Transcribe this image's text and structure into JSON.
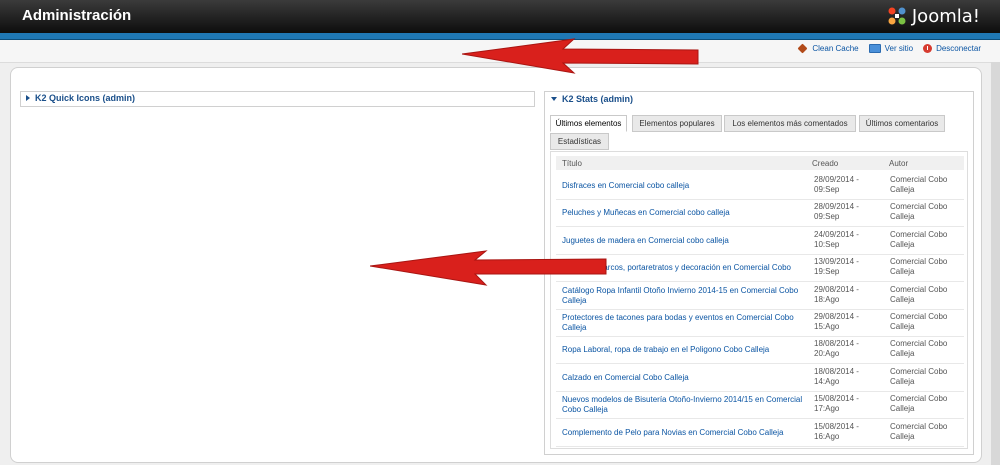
{
  "header": {
    "title": "Administración",
    "logo_text": "Joomla!"
  },
  "toolbar": {
    "clean_cache": "Clean Cache",
    "view_site": "Ver sitio",
    "logout": "Desconectar"
  },
  "left_panel": {
    "title": "K2 Quick Icons (admin)"
  },
  "right_panel": {
    "title": "K2 Stats (admin)",
    "tabs": [
      {
        "label": "Últimos elementos",
        "active": true
      },
      {
        "label": "Elementos populares",
        "active": false
      },
      {
        "label": "Los elementos más comentados",
        "active": false
      },
      {
        "label": "Últimos comentarios",
        "active": false
      },
      {
        "label": "Estadísticas",
        "active": false
      }
    ],
    "columns": {
      "title": "Título",
      "created": "Creado",
      "author": "Autor"
    },
    "rows": [
      {
        "title": "Disfraces en Comercial cobo calleja",
        "created": "28/09/2014 - 09:Sep",
        "author": "Comercial Cobo Calleja"
      },
      {
        "title": "Peluches y Muñecas en Comercial cobo calleja",
        "created": "28/09/2014 - 09:Sep",
        "author": "Comercial Cobo Calleja"
      },
      {
        "title": "Juguetes de madera en Comercial cobo calleja",
        "created": "24/09/2014 - 10:Sep",
        "author": "Comercial Cobo Calleja"
      },
      {
        "title": "Cuadros, marcos, portaretratos y decoración en Comercial Cobo",
        "created": "13/09/2014 - 19:Sep",
        "author": "Comercial Cobo Calleja"
      },
      {
        "title": "Catálogo Ropa Infantil Otoño Invierno 2014-15 en Comercial Cobo Calleja",
        "created": "29/08/2014 - 18:Ago",
        "author": "Comercial Cobo Calleja"
      },
      {
        "title": "Protectores de tacones para bodas y eventos en Comercial Cobo Calleja",
        "created": "29/08/2014 - 15:Ago",
        "author": "Comercial Cobo Calleja"
      },
      {
        "title": "Ropa Laboral, ropa de trabajo en el Poligono Cobo Calleja",
        "created": "18/08/2014 - 20:Ago",
        "author": "Comercial Cobo Calleja"
      },
      {
        "title": "Calzado en Comercial Cobo Calleja",
        "created": "18/08/2014 - 14:Ago",
        "author": "Comercial Cobo Calleja"
      },
      {
        "title": "Nuevos modelos de Bisutería Otoño-Invierno 2014/15 en Comercial Cobo Calleja",
        "created": "15/08/2014 - 17:Ago",
        "author": "Comercial Cobo Calleja"
      },
      {
        "title": "Complemento de Pelo para Novias en Comercial Cobo Calleja",
        "created": "15/08/2014 - 16:Ago",
        "author": "Comercial Cobo Calleja"
      }
    ]
  },
  "colors": {
    "header_bg": "#111111",
    "accent_blue": "#1f78b4",
    "link": "#0b55a3",
    "annotation_arrow": "#d9201c"
  }
}
